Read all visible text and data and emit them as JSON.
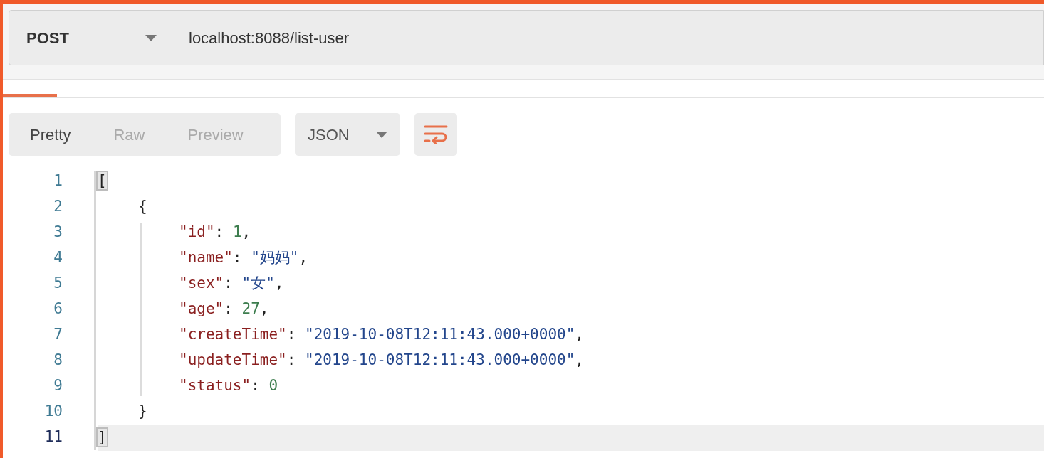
{
  "request": {
    "method": "POST",
    "url": "localhost:8088/list-user"
  },
  "format_tabs": [
    {
      "label": "Pretty",
      "selected": true
    },
    {
      "label": "Raw",
      "selected": false
    },
    {
      "label": "Preview",
      "selected": false
    }
  ],
  "format_select": "JSON",
  "code_lines": [
    {
      "number": "1",
      "current": false,
      "tokens": [
        {
          "kind": "bracket-match",
          "text": "["
        }
      ],
      "children": [
        {
          "number": "2",
          "current": false,
          "tokens": [
            {
              "kind": "punct",
              "text": "{"
            }
          ],
          "children": [
            {
              "number": "3",
              "current": false,
              "tokens": [
                {
                  "kind": "key",
                  "text": "\"id\""
                },
                {
                  "kind": "punct",
                  "text": ": "
                },
                {
                  "kind": "number",
                  "text": "1"
                },
                {
                  "kind": "punct",
                  "text": ","
                }
              ]
            },
            {
              "number": "4",
              "current": false,
              "tokens": [
                {
                  "kind": "key",
                  "text": "\"name\""
                },
                {
                  "kind": "punct",
                  "text": ": "
                },
                {
                  "kind": "string",
                  "text": "\"妈妈\""
                },
                {
                  "kind": "punct",
                  "text": ","
                }
              ]
            },
            {
              "number": "5",
              "current": false,
              "tokens": [
                {
                  "kind": "key",
                  "text": "\"sex\""
                },
                {
                  "kind": "punct",
                  "text": ": "
                },
                {
                  "kind": "string",
                  "text": "\"女\""
                },
                {
                  "kind": "punct",
                  "text": ","
                }
              ]
            },
            {
              "number": "6",
              "current": false,
              "tokens": [
                {
                  "kind": "key",
                  "text": "\"age\""
                },
                {
                  "kind": "punct",
                  "text": ": "
                },
                {
                  "kind": "number",
                  "text": "27"
                },
                {
                  "kind": "punct",
                  "text": ","
                }
              ]
            },
            {
              "number": "7",
              "current": false,
              "tokens": [
                {
                  "kind": "key",
                  "text": "\"createTime\""
                },
                {
                  "kind": "punct",
                  "text": ": "
                },
                {
                  "kind": "string",
                  "text": "\"2019-10-08T12:11:43.000+0000\""
                },
                {
                  "kind": "punct",
                  "text": ","
                }
              ]
            },
            {
              "number": "8",
              "current": false,
              "tokens": [
                {
                  "kind": "key",
                  "text": "\"updateTime\""
                },
                {
                  "kind": "punct",
                  "text": ": "
                },
                {
                  "kind": "string",
                  "text": "\"2019-10-08T12:11:43.000+0000\""
                },
                {
                  "kind": "punct",
                  "text": ","
                }
              ]
            },
            {
              "number": "9",
              "current": false,
              "tokens": [
                {
                  "kind": "key",
                  "text": "\"status\""
                },
                {
                  "kind": "punct",
                  "text": ": "
                },
                {
                  "kind": "number",
                  "text": "0"
                }
              ]
            }
          ]
        },
        {
          "number": "10",
          "current": false,
          "tokens": [
            {
              "kind": "punct",
              "text": "}"
            }
          ]
        }
      ]
    },
    {
      "number": "11",
      "current": true,
      "tokens": [
        {
          "kind": "bracket-match",
          "text": "]"
        }
      ]
    }
  ]
}
